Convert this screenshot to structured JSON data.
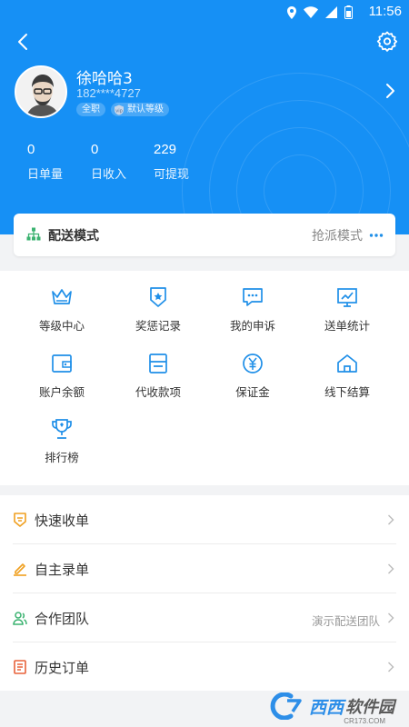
{
  "status_bar": {
    "time": "11:56"
  },
  "profile": {
    "name": "徐哈哈3",
    "phone": "182****4727",
    "role_tag": "全职",
    "level_tag": "默认等级"
  },
  "stats": [
    {
      "value": "0",
      "label": "日单量"
    },
    {
      "value": "0",
      "label": "日收入"
    },
    {
      "value": "229",
      "label": "可提现"
    }
  ],
  "delivery_mode": {
    "title": "配送模式",
    "value": "抢派模式"
  },
  "grid": [
    {
      "label": "等级中心",
      "icon": "crown-icon"
    },
    {
      "label": "奖惩记录",
      "icon": "badge-icon"
    },
    {
      "label": "我的申诉",
      "icon": "message-icon"
    },
    {
      "label": "送单统计",
      "icon": "chart-icon"
    },
    {
      "label": "账户余额",
      "icon": "wallet-icon"
    },
    {
      "label": "代收款项",
      "icon": "card-icon"
    },
    {
      "label": "保证金",
      "icon": "yuan-icon"
    },
    {
      "label": "线下结算",
      "icon": "home-icon"
    },
    {
      "label": "排行榜",
      "icon": "trophy-icon"
    }
  ],
  "menu": [
    {
      "label": "快速收单",
      "value": "",
      "icon": "quick-order-icon"
    },
    {
      "label": "自主录单",
      "value": "",
      "icon": "edit-icon"
    },
    {
      "label": "合作团队",
      "value": "演示配送团队",
      "icon": "team-icon"
    },
    {
      "label": "历史订单",
      "value": "",
      "icon": "history-icon"
    }
  ],
  "watermark": {
    "brand": "西西",
    "brand2": "软件园",
    "site": "CR173.COM"
  },
  "colors": {
    "primary": "#1690f5",
    "icon_blue": "#1f8fe8",
    "icon_orange": "#f0a020",
    "icon_green": "#3cb371",
    "icon_red": "#e8623a"
  }
}
